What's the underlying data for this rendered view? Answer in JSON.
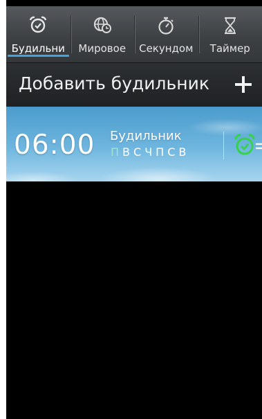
{
  "tabs": [
    {
      "label": "Будильни",
      "icon": "alarm-clock-icon",
      "active": true
    },
    {
      "label": "Мировое",
      "icon": "globe-clock-icon",
      "active": false
    },
    {
      "label": "Секундом",
      "icon": "stopwatch-icon",
      "active": false
    },
    {
      "label": "Таймер",
      "icon": "hourglass-icon",
      "active": false
    }
  ],
  "add_bar": {
    "label": "Добавить будильник",
    "icon": "plus-icon"
  },
  "alarms": [
    {
      "time": "06:00",
      "name": "Будильник",
      "days": [
        "П",
        "В",
        "С",
        "Ч",
        "П",
        "С",
        "В"
      ],
      "enabled": true
    }
  ],
  "colors": {
    "accent": "#40a5e3",
    "alarm_enabled": "#35d24a",
    "day_inactive": "#9fe3d5"
  }
}
